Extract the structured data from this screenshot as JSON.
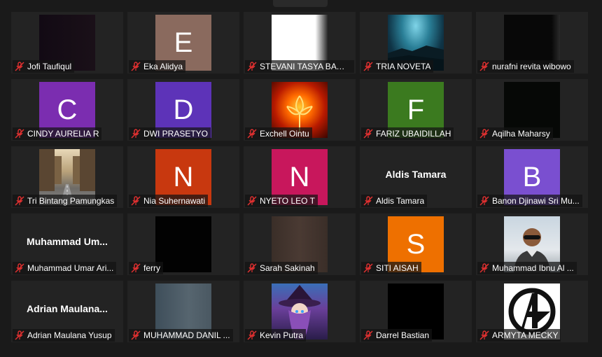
{
  "participants": [
    {
      "name": "Jofi Taufiqul",
      "tile": "video",
      "muted": true
    },
    {
      "name": "Eka Alidya",
      "tile": "letter",
      "letter": "E",
      "color": "#8a6a5e",
      "muted": true
    },
    {
      "name": "STEVANI TASYA BAWA...",
      "tile": "video",
      "muted": true
    },
    {
      "name": "TRIA NOVETA",
      "tile": "image",
      "muted": true
    },
    {
      "name": "nurafni revita wibowo",
      "tile": "video",
      "muted": true
    },
    {
      "name": "CINDY AURELIA R",
      "tile": "letter",
      "letter": "C",
      "color": "#7b2db0",
      "muted": true
    },
    {
      "name": "DWI PRASETYO",
      "tile": "letter",
      "letter": "D",
      "color": "#5d33b8",
      "muted": true
    },
    {
      "name": "Exchell Ointu",
      "tile": "image",
      "muted": true
    },
    {
      "name": "FARIZ UBAIDILLAH",
      "tile": "letter",
      "letter": "F",
      "color": "#3b7a1f",
      "muted": true
    },
    {
      "name": "Aqilha Maharsy",
      "tile": "video",
      "muted": true
    },
    {
      "name": "Tri Bintang Pamungkas",
      "tile": "image",
      "muted": true
    },
    {
      "name": "Nia Suhernawati",
      "tile": "letter",
      "letter": "N",
      "color": "#c8380f",
      "muted": true
    },
    {
      "name": "NYETO LEO T",
      "tile": "letter",
      "letter": "N",
      "color": "#c8175c",
      "muted": true
    },
    {
      "name": "Aldis Tamara",
      "tile": "text",
      "display": "Aldis Tamara",
      "muted": true
    },
    {
      "name": "Banon Djinawi Sri Mu...",
      "tile": "letter",
      "letter": "B",
      "color": "#7a4fd0",
      "muted": true
    },
    {
      "name": "Muhammad Umar Ari...",
      "tile": "text",
      "display": "Muhammad  Um...",
      "muted": true
    },
    {
      "name": "ferry",
      "tile": "video",
      "muted": true
    },
    {
      "name": "Sarah Sakinah",
      "tile": "video",
      "muted": true
    },
    {
      "name": "SITI AISAH",
      "tile": "letter",
      "letter": "S",
      "color": "#ee7000",
      "muted": true
    },
    {
      "name": "Muhammad Ibnu Al ...",
      "tile": "image",
      "muted": true
    },
    {
      "name": "Adrian Maulana Yusup",
      "tile": "text",
      "display": "Adrian  Maulana...",
      "muted": true
    },
    {
      "name": "MUHAMMAD DANIL ...",
      "tile": "video",
      "muted": true
    },
    {
      "name": "Kevin Putra",
      "tile": "image",
      "muted": true
    },
    {
      "name": "Darrel Bastian",
      "tile": "video",
      "muted": true
    },
    {
      "name": "ARMYTA MECKY",
      "tile": "image",
      "muted": true
    }
  ]
}
